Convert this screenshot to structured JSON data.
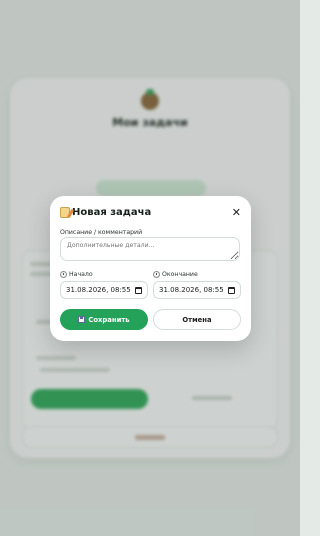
{
  "background": {
    "app_title": "Мои задачи"
  },
  "modal": {
    "title": "Новая задача",
    "close_icon": "close-icon",
    "description": {
      "label": "Описание / комментарий",
      "placeholder": "Дополнительные детали..."
    },
    "start": {
      "label": "Начало",
      "value": "31.08.2026, 08:55"
    },
    "end": {
      "label": "Окончание",
      "value": "31.08.2026, 08:55"
    },
    "save_label": "Сохранить",
    "cancel_label": "Отмена"
  },
  "colors": {
    "accent": "#24a259",
    "overlay": "#18221c"
  }
}
